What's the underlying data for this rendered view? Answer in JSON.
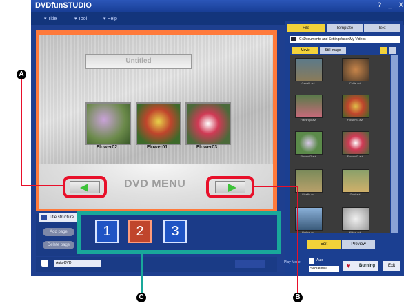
{
  "window": {
    "title": "DVDfunSTUDIO",
    "controls": "? _ X"
  },
  "menubar": {
    "items": [
      "Title",
      "Tool",
      "Help"
    ]
  },
  "canvas": {
    "title_box": "Untitled",
    "thumbnails": [
      "Flower02",
      "Flower01",
      "Flower03"
    ],
    "menu_text": "DVD MENU"
  },
  "left_panel": {
    "tab_label": "Title structure",
    "buttons": [
      "Add page",
      "Delete page"
    ]
  },
  "pages": [
    "1",
    "2",
    "3"
  ],
  "bottom": {
    "select_value": "Auto-DVD"
  },
  "right_panel": {
    "tabs": [
      "File",
      "Template",
      "Text"
    ],
    "path": "C:\\Documents and Settings\\user\\My Videos",
    "subtabs": [
      "Movie",
      "Still image"
    ],
    "gallery": [
      "Canal1.avi",
      "Collie.avi",
      "Flamingo.avi",
      "Flower01.avi",
      "Flower02.avi",
      "Flower03.avi",
      "Giraffe.avi",
      "Gobi.avi",
      "Harbor.avi",
      "Kitten.avi"
    ],
    "action_tabs": [
      "Edit",
      "Preview"
    ],
    "play_mode_label": "Play Mode",
    "auto_label": "Auto",
    "sequential_value": "Sequential",
    "burn_label": "Burning",
    "exit_label": "Exit"
  },
  "callouts": {
    "A": "A",
    "B": "B",
    "C": "C"
  },
  "colors": {
    "callout_red": "#e8102a",
    "callout_teal": "#19a89a",
    "app_blue": "#1e3f8f"
  }
}
